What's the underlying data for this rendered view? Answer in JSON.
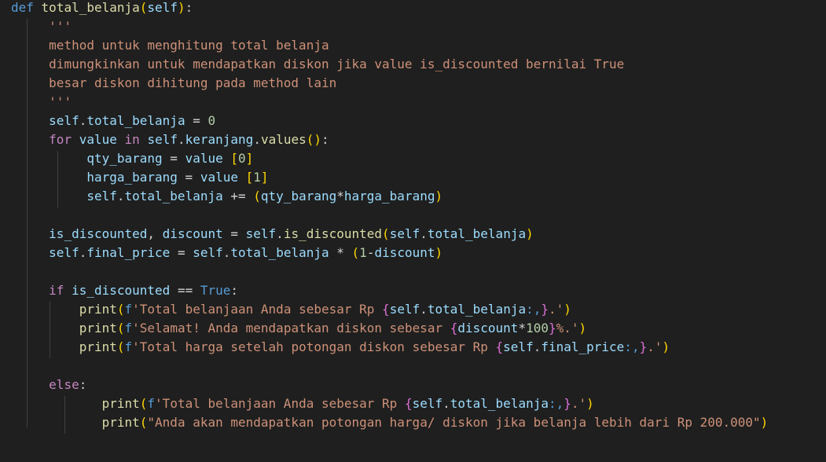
{
  "colors": {
    "background": "#1f1f1f",
    "keyword": "#569cd6",
    "control": "#c586c0",
    "function": "#dcdcaa",
    "variable": "#9cdcfe",
    "string": "#ce9178",
    "number": "#b5cea8",
    "operator": "#d4d4d4",
    "bracket_gold": "#ffd700",
    "bracket_pink": "#da70d6",
    "bracket_blue": "#179fff",
    "indent_guide": "#404040"
  },
  "code": {
    "lines": [
      {
        "indent": "",
        "tokens": [
          {
            "t": "def",
            "c": "keyword"
          },
          {
            "t": " "
          },
          {
            "t": "total_belanja",
            "c": "func"
          },
          {
            "t": "(",
            "c": "bracket1"
          },
          {
            "t": "self",
            "c": "var"
          },
          {
            "t": ")",
            "c": "bracket1"
          },
          {
            "t": ":"
          }
        ]
      },
      {
        "indent": "     ",
        "tokens": [
          {
            "t": "'''",
            "c": "string"
          }
        ]
      },
      {
        "indent": "     ",
        "tokens": [
          {
            "t": "method untuk menghitung total belanja",
            "c": "string"
          }
        ]
      },
      {
        "indent": "     ",
        "tokens": [
          {
            "t": "dimungkinkan untuk mendapatkan diskon jika value is_discounted bernilai True",
            "c": "string"
          }
        ]
      },
      {
        "indent": "     ",
        "tokens": [
          {
            "t": "besar diskon dihitung pada method lain",
            "c": "string"
          }
        ]
      },
      {
        "indent": "     ",
        "tokens": [
          {
            "t": "'''",
            "c": "string"
          }
        ]
      },
      {
        "indent": "     ",
        "tokens": [
          {
            "t": "self",
            "c": "var"
          },
          {
            "t": "."
          },
          {
            "t": "total_belanja",
            "c": "var"
          },
          {
            "t": " = ",
            "c": "op"
          },
          {
            "t": "0",
            "c": "number"
          }
        ]
      },
      {
        "indent": "     ",
        "tokens": [
          {
            "t": "for",
            "c": "control"
          },
          {
            "t": " "
          },
          {
            "t": "value",
            "c": "var"
          },
          {
            "t": " "
          },
          {
            "t": "in",
            "c": "control"
          },
          {
            "t": " "
          },
          {
            "t": "self",
            "c": "var"
          },
          {
            "t": "."
          },
          {
            "t": "keranjang",
            "c": "var"
          },
          {
            "t": "."
          },
          {
            "t": "values",
            "c": "func"
          },
          {
            "t": "()",
            "c": "bracket1"
          },
          {
            "t": ":"
          }
        ]
      },
      {
        "indent": "          ",
        "tokens": [
          {
            "t": "qty_barang",
            "c": "var"
          },
          {
            "t": " = ",
            "c": "op"
          },
          {
            "t": "value",
            "c": "var"
          },
          {
            "t": " "
          },
          {
            "t": "[",
            "c": "bracket1"
          },
          {
            "t": "0",
            "c": "number"
          },
          {
            "t": "]",
            "c": "bracket1"
          }
        ]
      },
      {
        "indent": "          ",
        "tokens": [
          {
            "t": "harga_barang",
            "c": "var"
          },
          {
            "t": " = ",
            "c": "op"
          },
          {
            "t": "value",
            "c": "var"
          },
          {
            "t": " "
          },
          {
            "t": "[",
            "c": "bracket1"
          },
          {
            "t": "1",
            "c": "number"
          },
          {
            "t": "]",
            "c": "bracket1"
          }
        ]
      },
      {
        "indent": "          ",
        "tokens": [
          {
            "t": "self",
            "c": "var"
          },
          {
            "t": "."
          },
          {
            "t": "total_belanja",
            "c": "var"
          },
          {
            "t": " += ",
            "c": "op"
          },
          {
            "t": "(",
            "c": "bracket1"
          },
          {
            "t": "qty_barang",
            "c": "var"
          },
          {
            "t": "*",
            "c": "op"
          },
          {
            "t": "harga_barang",
            "c": "var"
          },
          {
            "t": ")",
            "c": "bracket1"
          }
        ]
      },
      {
        "indent": "",
        "tokens": []
      },
      {
        "indent": "     ",
        "tokens": [
          {
            "t": "is_discounted",
            "c": "var"
          },
          {
            "t": ", "
          },
          {
            "t": "discount",
            "c": "var"
          },
          {
            "t": " = ",
            "c": "op"
          },
          {
            "t": "self",
            "c": "var"
          },
          {
            "t": "."
          },
          {
            "t": "is_discounted",
            "c": "func"
          },
          {
            "t": "(",
            "c": "bracket1"
          },
          {
            "t": "self",
            "c": "var"
          },
          {
            "t": "."
          },
          {
            "t": "total_belanja",
            "c": "var"
          },
          {
            "t": ")",
            "c": "bracket1"
          }
        ]
      },
      {
        "indent": "     ",
        "tokens": [
          {
            "t": "self",
            "c": "var"
          },
          {
            "t": "."
          },
          {
            "t": "final_price",
            "c": "var"
          },
          {
            "t": " = ",
            "c": "op"
          },
          {
            "t": "self",
            "c": "var"
          },
          {
            "t": "."
          },
          {
            "t": "total_belanja",
            "c": "var"
          },
          {
            "t": " * ",
            "c": "op"
          },
          {
            "t": "(",
            "c": "bracket1"
          },
          {
            "t": "1",
            "c": "number"
          },
          {
            "t": "-",
            "c": "op"
          },
          {
            "t": "discount",
            "c": "var"
          },
          {
            "t": ")",
            "c": "bracket1"
          }
        ]
      },
      {
        "indent": "",
        "tokens": []
      },
      {
        "indent": "     ",
        "tokens": [
          {
            "t": "if",
            "c": "control"
          },
          {
            "t": " "
          },
          {
            "t": "is_discounted",
            "c": "var"
          },
          {
            "t": " == ",
            "c": "op"
          },
          {
            "t": "True",
            "c": "keyword"
          },
          {
            "t": ":"
          }
        ]
      },
      {
        "indent": "         ",
        "tokens": [
          {
            "t": "print",
            "c": "func"
          },
          {
            "t": "(",
            "c": "bracket1"
          },
          {
            "t": "f",
            "c": "keyword"
          },
          {
            "t": "'Total belanjaan Anda sebesar Rp ",
            "c": "string"
          },
          {
            "t": "{",
            "c": "bracket2"
          },
          {
            "t": "self",
            "c": "var"
          },
          {
            "t": "."
          },
          {
            "t": "total_belanja",
            "c": "var"
          },
          {
            "t": ":,",
            "c": "keyword"
          },
          {
            "t": "}",
            "c": "bracket2"
          },
          {
            "t": ".'",
            "c": "string"
          },
          {
            "t": ")",
            "c": "bracket1"
          }
        ]
      },
      {
        "indent": "         ",
        "tokens": [
          {
            "t": "print",
            "c": "func"
          },
          {
            "t": "(",
            "c": "bracket1"
          },
          {
            "t": "f",
            "c": "keyword"
          },
          {
            "t": "'Selamat! Anda mendapatkan diskon sebesar ",
            "c": "string"
          },
          {
            "t": "{",
            "c": "bracket2"
          },
          {
            "t": "discount",
            "c": "var"
          },
          {
            "t": "*",
            "c": "op"
          },
          {
            "t": "100",
            "c": "number"
          },
          {
            "t": "}",
            "c": "bracket2"
          },
          {
            "t": "%.'",
            "c": "string"
          },
          {
            "t": ")",
            "c": "bracket1"
          }
        ]
      },
      {
        "indent": "         ",
        "tokens": [
          {
            "t": "print",
            "c": "func"
          },
          {
            "t": "(",
            "c": "bracket1"
          },
          {
            "t": "f",
            "c": "keyword"
          },
          {
            "t": "'Total harga setelah potongan diskon sebesar Rp ",
            "c": "string"
          },
          {
            "t": "{",
            "c": "bracket2"
          },
          {
            "t": "self",
            "c": "var"
          },
          {
            "t": "."
          },
          {
            "t": "final_price",
            "c": "var"
          },
          {
            "t": ":,",
            "c": "keyword"
          },
          {
            "t": "}",
            "c": "bracket2"
          },
          {
            "t": ".'",
            "c": "string"
          },
          {
            "t": ")",
            "c": "bracket1"
          }
        ]
      },
      {
        "indent": "",
        "tokens": []
      },
      {
        "indent": "     ",
        "tokens": [
          {
            "t": "else",
            "c": "control"
          },
          {
            "t": ":"
          }
        ]
      },
      {
        "indent": "            ",
        "tokens": [
          {
            "t": "print",
            "c": "func"
          },
          {
            "t": "(",
            "c": "bracket1"
          },
          {
            "t": "f",
            "c": "keyword"
          },
          {
            "t": "'Total belanjaan Anda sebesar Rp ",
            "c": "string"
          },
          {
            "t": "{",
            "c": "bracket2"
          },
          {
            "t": "self",
            "c": "var"
          },
          {
            "t": "."
          },
          {
            "t": "total_belanja",
            "c": "var"
          },
          {
            "t": ":,",
            "c": "keyword"
          },
          {
            "t": "}",
            "c": "bracket2"
          },
          {
            "t": ".'",
            "c": "string"
          },
          {
            "t": ")",
            "c": "bracket1"
          }
        ]
      },
      {
        "indent": "            ",
        "tokens": [
          {
            "t": "print",
            "c": "func"
          },
          {
            "t": "(",
            "c": "bracket1"
          },
          {
            "t": "\"Anda akan mendapatkan potongan harga/ diskon jika belanja lebih dari Rp 200.000\"",
            "c": "string"
          },
          {
            "t": ")",
            "c": "bracket1"
          }
        ]
      }
    ]
  }
}
